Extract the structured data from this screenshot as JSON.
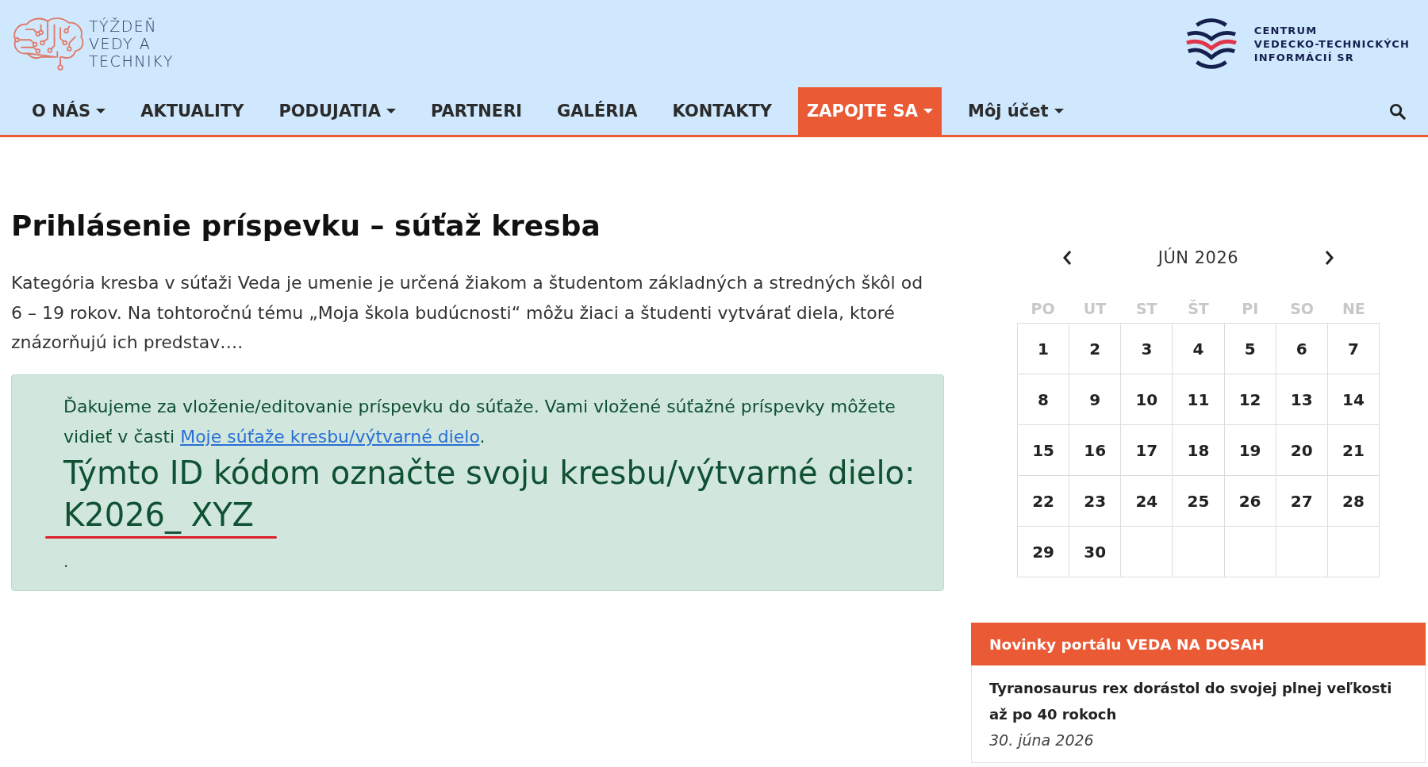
{
  "header": {
    "logo": {
      "lines": [
        "TÝŽDEŇ",
        "VEDY A",
        "TECHNIKY"
      ]
    },
    "partner_logo": {
      "lines": [
        "CENTRUM",
        "VEDECKO-TECHNICKÝCH",
        "INFORMÁCIÍ SR"
      ]
    }
  },
  "nav": {
    "items": [
      {
        "label": "O NÁS",
        "dropdown": true,
        "selected": false
      },
      {
        "label": "AKTUALITY",
        "dropdown": false,
        "selected": false
      },
      {
        "label": "PODUJATIA",
        "dropdown": true,
        "selected": false
      },
      {
        "label": "PARTNERI",
        "dropdown": false,
        "selected": false
      },
      {
        "label": "GALÉRIA",
        "dropdown": false,
        "selected": false
      },
      {
        "label": "KONTAKTY",
        "dropdown": false,
        "selected": false
      },
      {
        "label": "ZAPOJTE SA",
        "dropdown": true,
        "selected": true
      },
      {
        "label": "Môj účet",
        "dropdown": true,
        "selected": false
      }
    ]
  },
  "page": {
    "title": "Prihlásenie príspevku – súťaž kresba",
    "intro": "Kategória kresba v súťaži Veda je umenie je určená žiakom a študentom základných a stredných škôl od 6 – 19 rokov. Na tohtoročnú tému „Moja škola budúcnosti“ môžu žiaci a študenti vytvárať diela, ktoré znázorňujú ich predstav….",
    "alert": {
      "message": "Ďakujeme za vloženie/editovanie príspevku do súťaže. Vami vložené súťažné príspevky môžete vidieť v časti",
      "link": "Moje súťaže kresbu/výtvarné dielo",
      "message_end": ".",
      "code_label": "Týmto ID kódom označte svoju kresbu/výtvarné dielo:",
      "code": {
        "text": "K2026_ XYZ",
        "underlined": true
      },
      "footnote": "."
    }
  },
  "calendar": {
    "month": "JÚN 2026",
    "weekdays": [
      "PO",
      "UT",
      "ST",
      "ŠT",
      "PI",
      "SO",
      "NE"
    ],
    "weeks": [
      [
        "1",
        "2",
        "3",
        "4",
        "5",
        "6",
        "7"
      ],
      [
        "8",
        "9",
        "10",
        "11",
        "12",
        "13",
        "14"
      ],
      [
        "15",
        "16",
        "17",
        "18",
        "19",
        "20",
        "21"
      ],
      [
        "22",
        "23",
        "24",
        "25",
        "26",
        "27",
        "28"
      ],
      [
        "29",
        "30"
      ]
    ]
  },
  "news": {
    "heading": "Novinky portálu VEDA NA DOSAH",
    "items": [
      {
        "title": "Tyranosaurus rex dorástol do svojej plnej veľkosti až po 40 rokoch",
        "date": "30. júna 2026"
      }
    ]
  }
}
